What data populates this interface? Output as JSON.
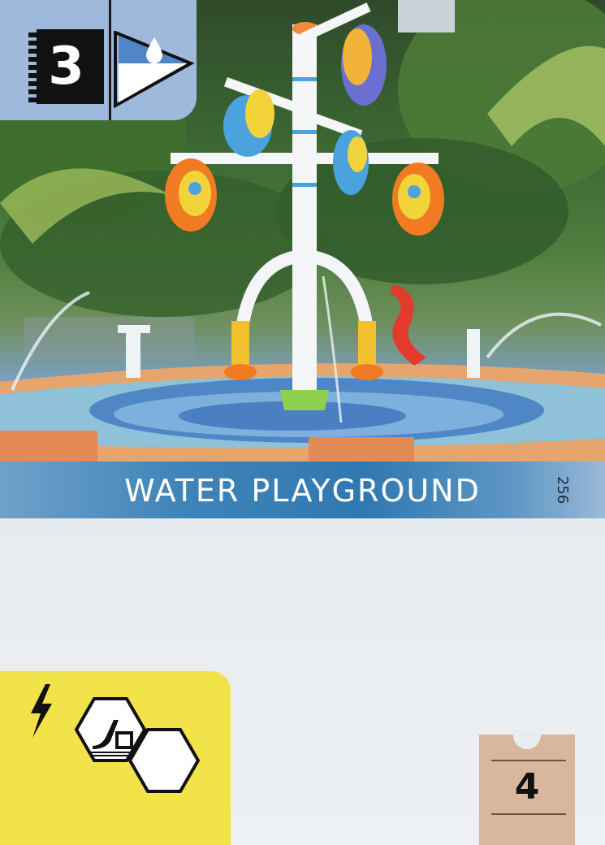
{
  "card": {
    "cost": "3",
    "title": "WATER PLAYGROUND",
    "card_number": "256",
    "victory_points": "4",
    "tag_icon": "water-drop-icon",
    "requirement_icons": [
      "lightning-bolt-icon",
      "slide-playground-hex-icon",
      "empty-hex-icon"
    ]
  },
  "colors": {
    "badge": "#9eb9dc",
    "title_band": "#2f78b0",
    "condition_panel": "#f3e34a",
    "vp_tag": "#d9b79f"
  }
}
